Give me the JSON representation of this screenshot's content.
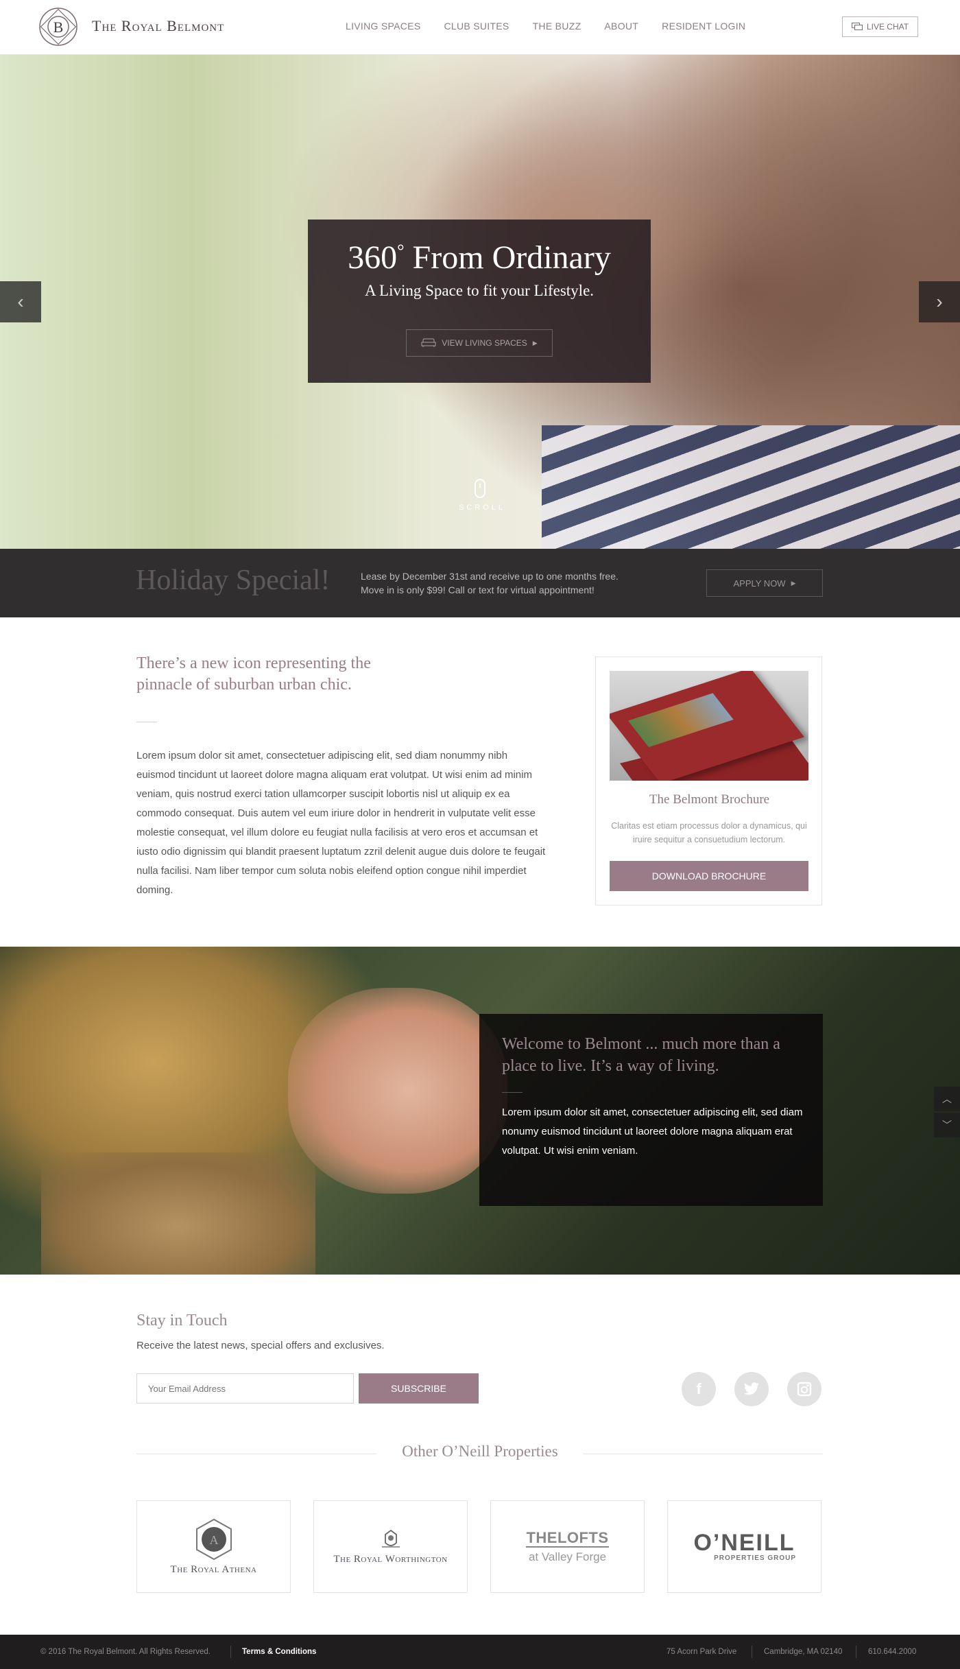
{
  "header": {
    "logo_initial": "B",
    "brand": "The Royal Belmont",
    "nav": [
      "Living Spaces",
      "Club Suites",
      "The Buzz",
      "About",
      "Resident Login"
    ],
    "chat_label": "Live Chat"
  },
  "hero": {
    "title_num": "360",
    "title_deg": "°",
    "title_rest": " From Ordinary",
    "subtitle": "A Living Space to fit your Lifestyle.",
    "cta": "View Living Spaces",
    "scroll": "SCROLL"
  },
  "holiday": {
    "title": "Holiday Special!",
    "line1": "Lease by December 31st and receive up to one months free.",
    "line2": "Move in is only $99! Call or text for virtual appointment!",
    "cta": "Apply Now"
  },
  "intro": {
    "heading": "There’s a new icon representing the pinnacle of suburban urban chic.",
    "body": "Lorem ipsum dolor sit amet, consectetuer adipiscing elit, sed diam nonummy nibh euismod tincidunt ut laoreet dolore magna aliquam erat volutpat. Ut wisi enim ad minim veniam, quis nostrud exerci tation ullamcorper suscipit lobortis nisl ut aliquip ex ea commodo consequat. Duis autem vel eum iriure dolor in hendrerit in vulputate velit esse molestie consequat, vel illum dolore eu feugiat nulla facilisis at vero eros et accumsan et iusto odio dignissim qui blandit praesent luptatum zzril delenit augue duis dolore te feugait nulla facilisi. Nam liber tempor cum soluta nobis eleifend option congue nihil imperdiet doming."
  },
  "brochure": {
    "title": "The Belmont Brochure",
    "text": "Claritas est etiam processus dolor a dynamicus, qui iruire sequitur a consuetudium lectorum.",
    "cta": "Download Brochure"
  },
  "welcome": {
    "title": "Welcome to Belmont ... much more than a place to live. It’s a way of living.",
    "body": "Lorem ipsum dolor sit amet, consectetuer adipiscing elit, sed diam nonumy euismod tincidunt ut laoreet dolore magna aliquam erat volutpat. Ut wisi enim veniam."
  },
  "newsletter": {
    "title": "Stay in Touch",
    "subtitle": "Receive the latest news, special offers and exclusives.",
    "placeholder": "Your Email Address",
    "cta": "Subscribe"
  },
  "social": [
    "facebook-icon",
    "twitter-icon",
    "instagram-icon"
  ],
  "properties": {
    "title": "Other O’Neill Properties",
    "athena": "The Royal Athena",
    "worthington": "The Royal Worthington",
    "lofts_a": "THELOFTS",
    "lofts_b": "at Valley Forge",
    "oneill_a": "O’NEILL",
    "oneill_b": "PROPERTIES GROUP"
  },
  "footer": {
    "copyright": "© 2016 The Royal Belmont. All Rights Reserved.",
    "terms": "Terms & Conditions",
    "address": "75 Acorn Park Drive",
    "city": "Cambridge, MA 02140",
    "phone": "610.644.2000"
  },
  "colors": {
    "accent": "#9a7b88",
    "dark": "#1f1d1e"
  }
}
